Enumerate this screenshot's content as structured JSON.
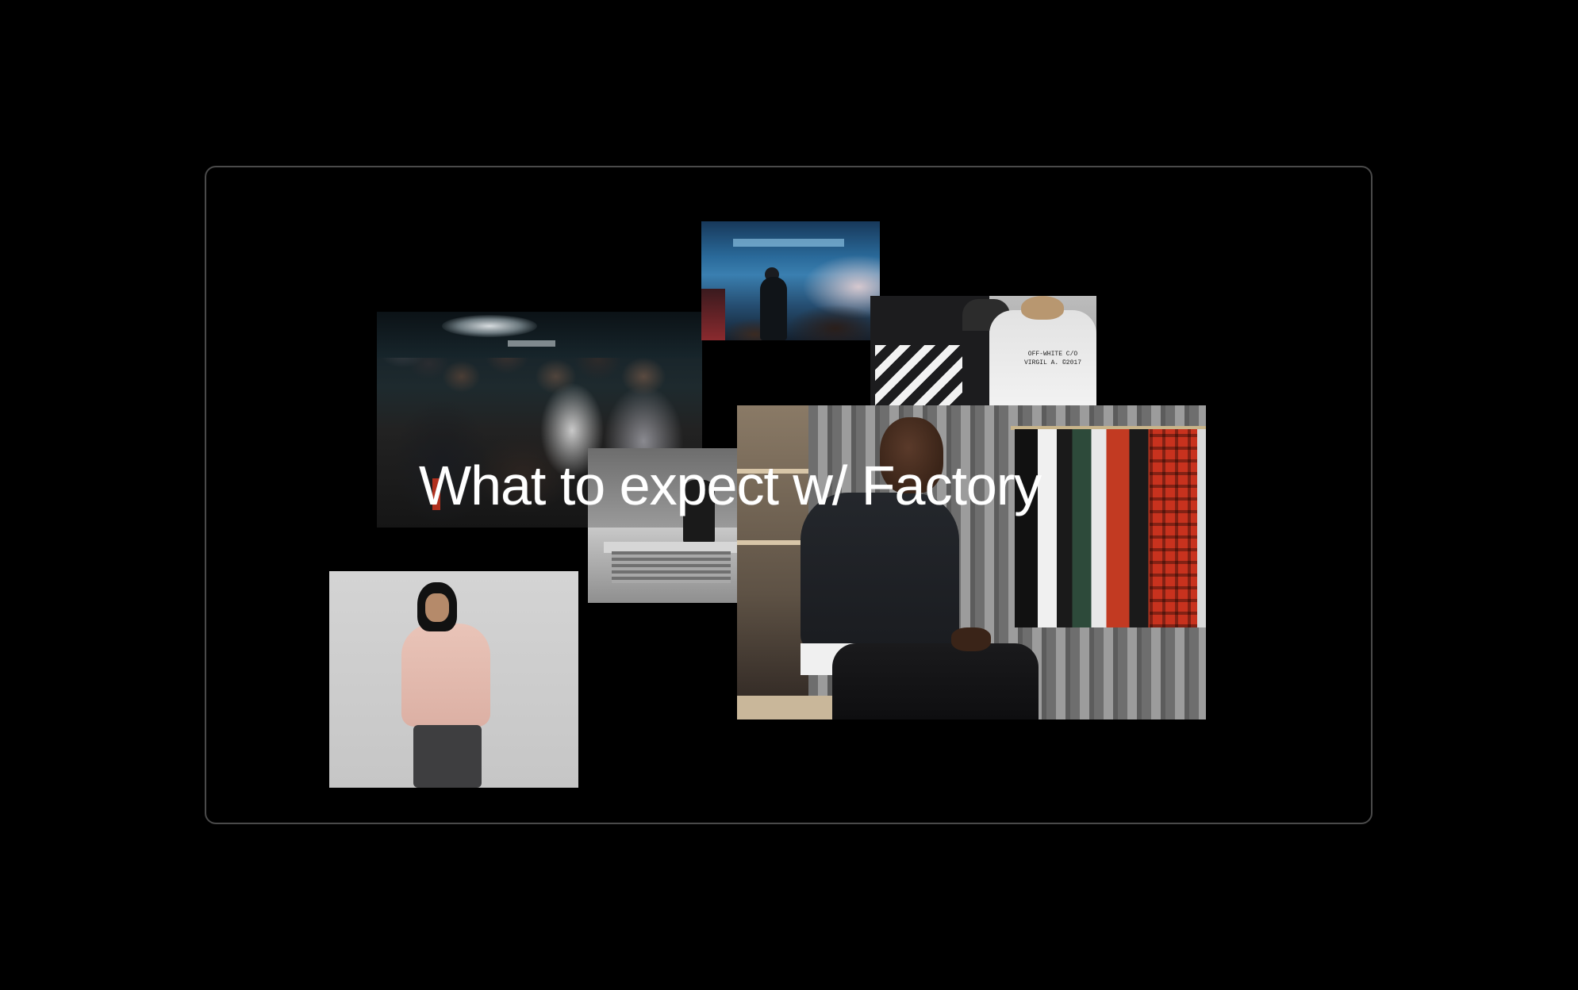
{
  "hero": {
    "headline": "What to expect w/ Factory"
  },
  "photos": [
    {
      "name": "crowd-photo",
      "icon": "party-crowd-image"
    },
    {
      "name": "concert-photo",
      "icon": "stage-performer-image"
    },
    {
      "name": "jacket-photo",
      "icon": "striped-jacket-image",
      "print_text": "OFF-WHITE C/O VIRGIL A. ©2017"
    },
    {
      "name": "store-photo",
      "icon": "store-interior-image"
    },
    {
      "name": "designer-photo",
      "icon": "seated-designer-image"
    },
    {
      "name": "hoodie-photo",
      "icon": "pink-hoodie-portrait-image"
    }
  ],
  "colors": {
    "background": "#000000",
    "frame_border": "#4a4a4a",
    "headline": "#ffffff"
  }
}
